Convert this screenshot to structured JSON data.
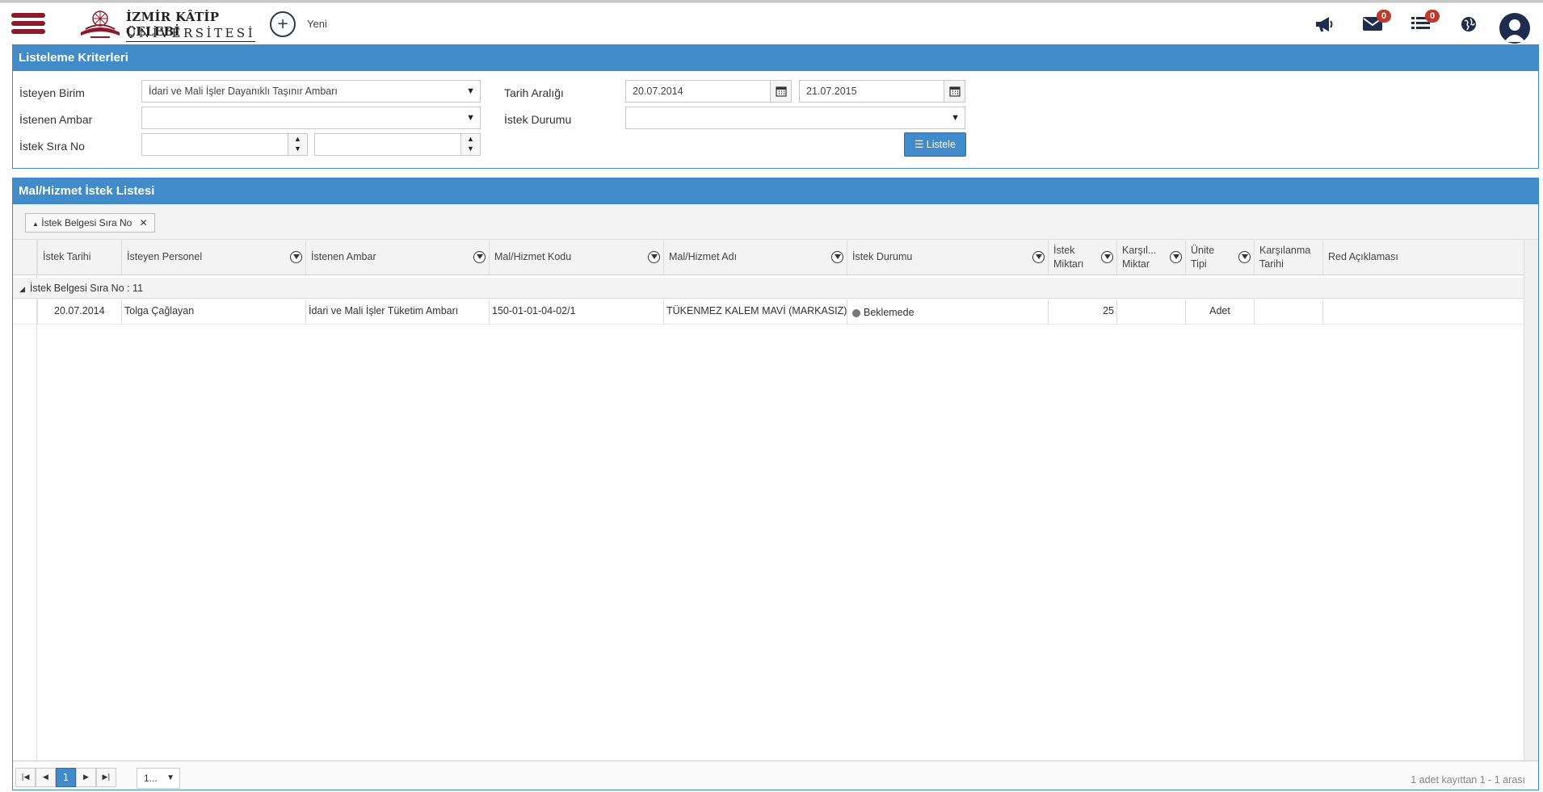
{
  "header": {
    "logo_line1": "İZMİR KÂTİP ÇELEBİ",
    "logo_line2": "ÜNİVERSİTESİ",
    "new_label": "Yeni",
    "mail_count": "0",
    "list_count": "0"
  },
  "criteria": {
    "title": "Listeleme Kriterleri",
    "isteyen_birim_label": "İsteyen Birim",
    "isteyen_birim_value": "İdari ve Mali İşler Dayanıklı Taşınır Ambarı",
    "istenen_ambar_label": "İstenen Ambar",
    "istenen_ambar_value": "",
    "istek_sira_no_label": "İstek Sıra No",
    "istek_sira_no_from": "",
    "istek_sira_no_to": "",
    "tarih_araligi_label": "Tarih Aralığı",
    "date_from": "20.07.2014",
    "date_to": "21.07.2015",
    "istek_durumu_label": "İstek Durumu",
    "istek_durumu_value": "",
    "listele_label": "Listele"
  },
  "list": {
    "title": "Mal/Hizmet İstek Listesi",
    "group_chip": "İstek Belgesi Sıra No",
    "columns": {
      "istek_tarihi": "İstek Tarihi",
      "isteyen_personel": "İsteyen Personel",
      "istenen_ambar": "İstenen Ambar",
      "mal_hizmet_kodu": "Mal/Hizmet Kodu",
      "mal_hizmet_adi": "Mal/Hizmet Adı",
      "istek_durumu": "İstek Durumu",
      "istek_miktari_1": "İstek",
      "istek_miktari_2": "Miktarı",
      "karsilanan_miktar_1": "Karşıl...",
      "karsilanan_miktar_2": "Miktar",
      "unite_tipi_1": "Ünite",
      "unite_tipi_2": "Tipi",
      "karsilanma_tarihi_1": "Karşılanma",
      "karsilanma_tarihi_2": "Tarihi",
      "red_aciklamasi": "Red Açıklaması"
    },
    "group_row": "İstek Belgesi Sıra No : 11",
    "rows": [
      {
        "istek_tarihi": "20.07.2014",
        "isteyen_personel": "Tolga Çağlayan",
        "istenen_ambar": "İdari ve Mali İşler Tüketim Ambarı",
        "mal_hizmet_kodu": "150-01-01-04-02/1",
        "mal_hizmet_adi": "TÜKENMEZ KALEM MAVİ (MARKASIZ)",
        "istek_durumu": "Beklemede",
        "istek_miktari": "25",
        "karsilanan_miktar": "",
        "unite_tipi": "Adet",
        "karsilanma_tarihi": "",
        "red_aciklamasi": ""
      }
    ],
    "pager": {
      "current_page": "1",
      "page_size": "1...",
      "info": "1 adet kayıttan 1 - 1 arası"
    }
  },
  "colors": {
    "brand": "#8b1a2a",
    "panel_header": "#428bca",
    "badge": "#c0392b",
    "status_waiting": "#777777"
  }
}
